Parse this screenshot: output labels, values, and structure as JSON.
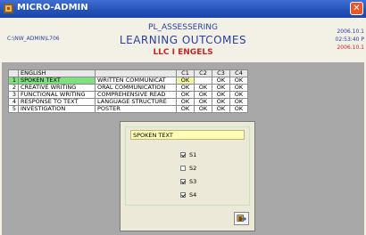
{
  "window": {
    "title": "MICRO-ADMIN"
  },
  "header": {
    "path": "C:\\NW_ADMIN\\L706",
    "line1": "PL_ASSESSERING",
    "line2": "LEARNING OUTCOMES",
    "line3": "LLC I ENGELS",
    "date": "2006.10.1",
    "time": "02:53:40 P",
    "date2": "2006.10.1"
  },
  "grid": {
    "subject": "ENGLISH",
    "columns": [
      "C1",
      "C2",
      "C3",
      "C4"
    ],
    "rows": [
      {
        "n": "1",
        "name": "SPOKEN TEXT",
        "desc": "WRITTEN COMMUNICAT",
        "c": [
          "OK",
          "",
          "OK",
          "OK"
        ]
      },
      {
        "n": "2",
        "name": "CREATIVE WRITING",
        "desc": "ORAL COMMUNICATION",
        "c": [
          "OK",
          "OK",
          "OK",
          "OK"
        ]
      },
      {
        "n": "3",
        "name": "FUNCTIONAL WRITING",
        "desc": "COMPREHENSIVE READ",
        "c": [
          "OK",
          "OK",
          "OK",
          "OK"
        ]
      },
      {
        "n": "4",
        "name": "RESPONSE TO TEXT",
        "desc": "LANGUAGE STRUCTURE",
        "c": [
          "OK",
          "OK",
          "OK",
          "OK"
        ]
      },
      {
        "n": "5",
        "name": "INVESTIGATION",
        "desc": "POSTER",
        "c": [
          "OK",
          "OK",
          "OK",
          "OK"
        ]
      }
    ]
  },
  "dialog": {
    "field": "SPOKEN TEXT",
    "checks": [
      {
        "label": "S1",
        "checked": true
      },
      {
        "label": "S2",
        "checked": false
      },
      {
        "label": "S3",
        "checked": true
      },
      {
        "label": "S4",
        "checked": true
      }
    ]
  }
}
